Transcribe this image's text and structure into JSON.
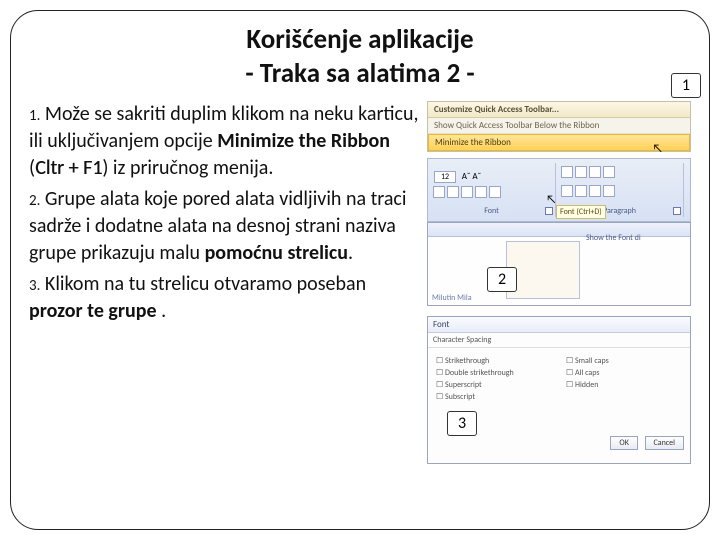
{
  "title_line1": "Korišćenje aplikacije",
  "title_line2": "- Traka sa alatima 2 -",
  "bullets": {
    "n1": "1.",
    "t1a": "Može se sakriti duplim klikom na neku karticu, ili uključivanjem opcije ",
    "t1b": "Minimize the Ribbon",
    "t1c": " (",
    "t1d": "Cltr + F1",
    "t1e": ") iz priručnog menija.",
    "n2": "2.",
    "t2a": "Grupe alata koje pored alata vidljivih na traci sadrže i dodatne alata na desnoj strani naziva grupe prikazuju malu ",
    "t2b": "pomoćnu strelicu",
    "t2c": ".",
    "n3": "3.",
    "t3a": "Klikom na tu strelicu otvaramo poseban ",
    "t3b": "prozor te grupe",
    "t3c": " ."
  },
  "callouts": {
    "c1": "1",
    "c2": "2",
    "c3": "3"
  },
  "panel1": {
    "head": "Customize Quick Access Toolbar...",
    "row1": "Show Quick Access Toolbar Below the Ribbon",
    "row2": "Minimize the Ribbon"
  },
  "ribbon": {
    "sel": "12",
    "g_font": "Font",
    "g_para": "Paragraph",
    "tip": "Font (Ctrl+D)"
  },
  "dlg2": {
    "side": "Show the Font di",
    "author": "Milutin Mila"
  },
  "dlg3": {
    "title": "Font",
    "tabs": "Character Spacing",
    "left_items": [
      "Strikethrough",
      "Double strikethrough",
      "Superscript",
      "Subscript"
    ],
    "right_items": [
      "Small caps",
      "All caps",
      "Hidden"
    ],
    "ok": "OK",
    "cancel": "Cancel"
  }
}
